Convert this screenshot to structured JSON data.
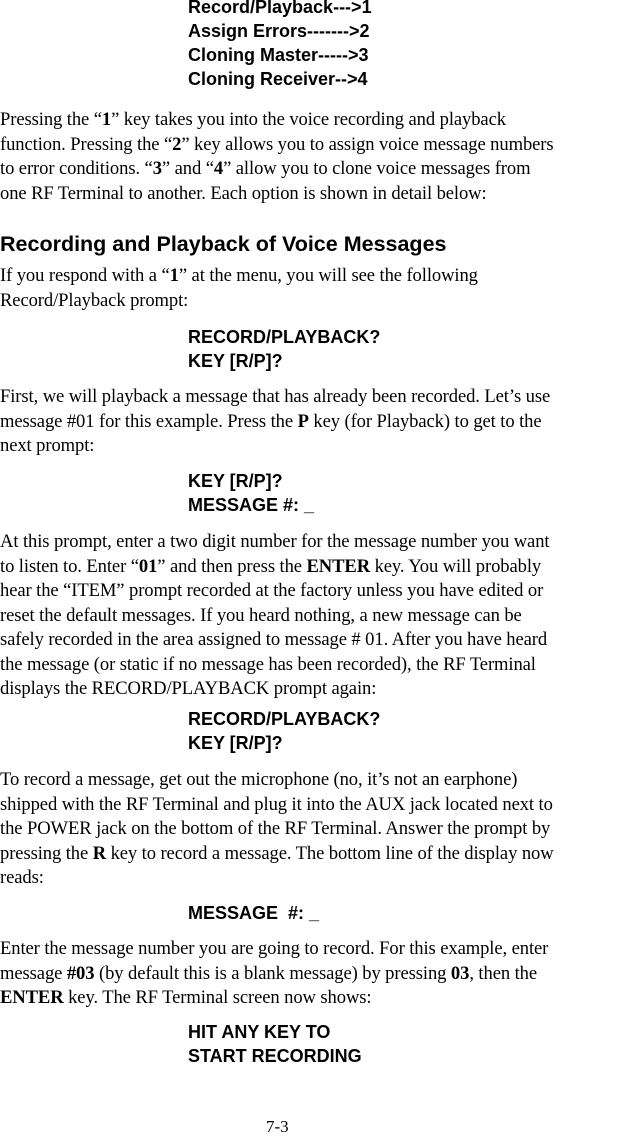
{
  "menu_prompt": [
    "Record/Playback--->1",
    "Assign Errors------->2",
    "Cloning Master----->3",
    "Cloning Receiver-->4"
  ],
  "para1": {
    "l1": [
      "Pressing the “",
      "1",
      "” key takes you into the voice recording and playback"
    ],
    "l2": [
      "function.  Pressing the “",
      "2",
      "” key allows you to assign voice message numbers"
    ],
    "l3": [
      "to error conditions. “",
      "3",
      "” and “",
      "4",
      "” allow you to clone voice messages from"
    ],
    "l4": "one RF Terminal to another.  Each option is shown in detail below:"
  },
  "section_heading": "Recording and Playback of Voice Messages",
  "para2": {
    "l1": [
      "If you respond with a “",
      "1",
      "” at the menu, you will see the following"
    ],
    "l2": "Record/Playback prompt:"
  },
  "prompt1": [
    "RECORD/PLAYBACK?",
    "KEY [R/P]?"
  ],
  "para3": {
    "l1": "First, we will playback a message that has already been recorded. Let’s use",
    "l2": [
      "message #01 for this example. Press the ",
      "P",
      " key (for Playback) to get to the"
    ],
    "l3": "next prompt:"
  },
  "prompt2": [
    "KEY [R/P]?",
    "MESSAGE #: _"
  ],
  "para4": {
    "l1": "At this prompt, enter a two digit number for the message number you want",
    "l2": [
      "to listen to.  Enter “",
      "01",
      "” and then press the ",
      "ENTER",
      " key. You will probably"
    ],
    "l3": "hear the “ITEM” prompt recorded at the factory unless you have edited or",
    "l4": "reset the default messages. If you heard nothing, a new message can be",
    "l5": "safely recorded in the area assigned to message # 01. After you have heard",
    "l6": "the message (or static if no message has been recorded), the RF Terminal",
    "l7": "displays the RECORD/PLAYBACK prompt again:"
  },
  "prompt3": [
    "RECORD/PLAYBACK?",
    "KEY [R/P]?"
  ],
  "para5": {
    "l1": "To record a message, get out the microphone (no, it’s not an earphone)",
    "l2": "shipped with the RF Terminal and plug it into the AUX jack located next to",
    "l3": "the POWER jack on the bottom of the RF Terminal. Answer the prompt by",
    "l4": [
      "pressing the ",
      "R",
      " key to record a message. The bottom line of the display now"
    ],
    "l5": "reads:"
  },
  "prompt4": [
    "MESSAGE  #: _"
  ],
  "para6": {
    "l1": "Enter the message number you are going to record. For this example, enter",
    "l2": [
      "message ",
      "#03",
      " (by default this is a blank message) by pressing ",
      "03",
      ", then the"
    ],
    "l3": [
      "ENTER",
      " key. The RF Terminal screen now shows:"
    ]
  },
  "prompt5": [
    "HIT ANY KEY TO",
    "START RECORDING"
  ],
  "page_number": "7-3"
}
